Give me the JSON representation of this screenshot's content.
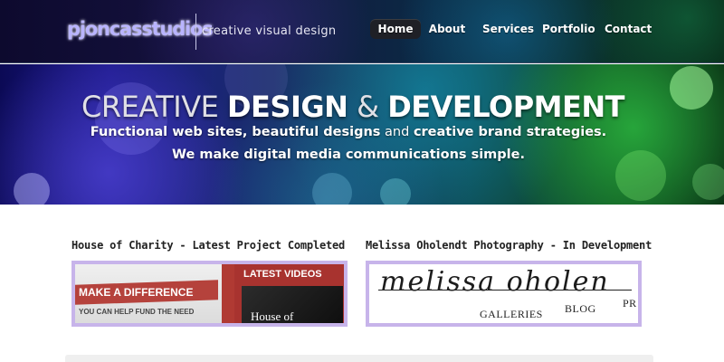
{
  "header": {
    "logo_text": "pjoncasstudios",
    "tagline": "creative visual design",
    "nav": [
      {
        "label": "Home",
        "active": true
      },
      {
        "label": "About",
        "active": false
      },
      {
        "label": "Services",
        "active": false
      },
      {
        "label": "Portfolio",
        "active": false
      },
      {
        "label": "Contact",
        "active": false
      }
    ]
  },
  "hero": {
    "title_part1": "CREATIVE",
    "title_part2": "DESIGN",
    "title_part3": "&",
    "title_part4": "DEVELOPMENT",
    "sub1_bold_a": "Functional web sites, beautiful designs",
    "sub1_plain": "and",
    "sub1_bold_b": "creative brand strategies.",
    "sub2": "We make digital media communications simple."
  },
  "projects": [
    {
      "title": "House of Charity - Latest Project Completed",
      "thumb_band": "MAKE A DIFFERENCE",
      "thumb_small": "YOU CAN HELP FUND THE NEED",
      "thumb_videos": "LATEST VIDEOS",
      "thumb_video_text": "House of"
    },
    {
      "title": "Melissa Oholendt Photography - In Development",
      "thumb_script": "melissa oholen",
      "thumb_nav": [
        "GALLERIES",
        "BLOG",
        "PR"
      ]
    }
  ],
  "colors": {
    "thumb_border": "#c7b4ea",
    "charity_red": "#b5423c",
    "nav_active_bg": "#1f2026"
  }
}
